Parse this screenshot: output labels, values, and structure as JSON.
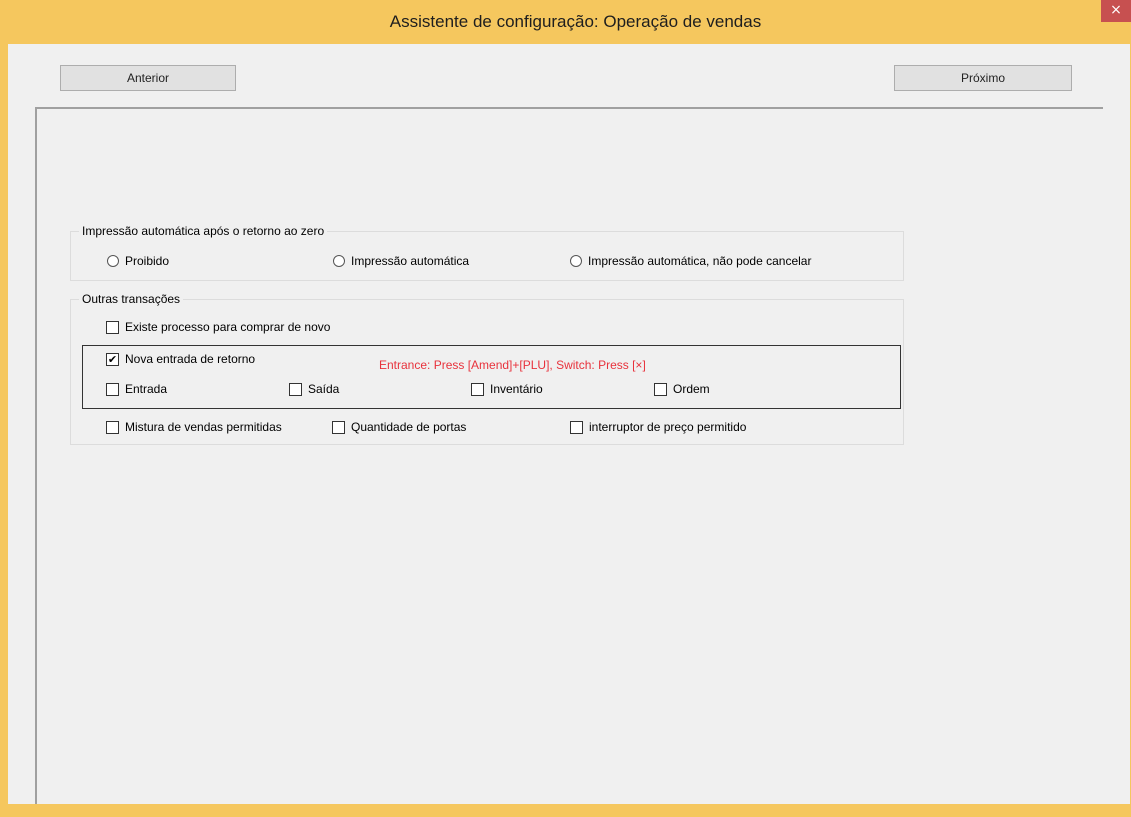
{
  "window": {
    "title": "Assistente de configuração: Operação de vendas",
    "close_glyph": "×"
  },
  "nav": {
    "prev_label": "Anterior",
    "next_label": "Próximo"
  },
  "auto_print": {
    "legend": "Impressão automática após o retorno ao zero",
    "options": [
      {
        "label": "Proibido",
        "selected": false
      },
      {
        "label": "Impressão automática",
        "selected": false
      },
      {
        "label": "Impressão automática, não pode cancelar",
        "selected": false
      }
    ]
  },
  "other": {
    "legend": "Outras transações",
    "rebuy": {
      "label": "Existe processo para comprar de novo",
      "checked": false
    },
    "return_entry": {
      "label": "Nova entrada de retorno",
      "checked": true
    },
    "hint": "Entrance: Press [Amend]+[PLU], Switch: Press [×]",
    "sub": [
      {
        "label": "Entrada",
        "checked": false
      },
      {
        "label": "Saída",
        "checked": false
      },
      {
        "label": "Inventário",
        "checked": false
      },
      {
        "label": "Ordem",
        "checked": false
      }
    ],
    "bottom": [
      {
        "label": "Mistura de vendas permitidas",
        "checked": false
      },
      {
        "label": "Quantidade de portas",
        "checked": false
      },
      {
        "label": "interruptor de preço permitido",
        "checked": false
      }
    ]
  },
  "colors": {
    "frame": "#f5c75e",
    "close_bg": "#c75050",
    "hint": "#e8323c"
  }
}
